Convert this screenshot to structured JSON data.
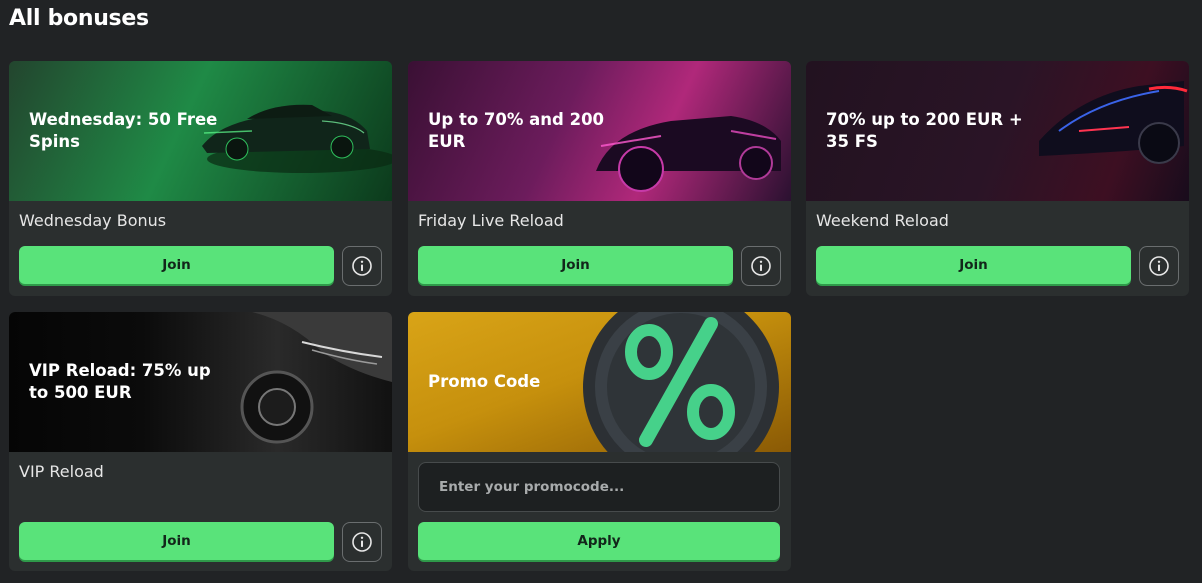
{
  "page": {
    "title": "All bonuses"
  },
  "bonuses": [
    {
      "headline": "Wednesday: 50 Free Spins",
      "name": "Wednesday Bonus",
      "button": "Join"
    },
    {
      "headline": "Up to 70% and 200 EUR",
      "name": "Friday Live Reload",
      "button": "Join"
    },
    {
      "headline": "70% up to 200 EUR + 35 FS",
      "name": "Weekend Reload",
      "button": "Join"
    },
    {
      "headline": "VIP Reload: 75% up to 500 EUR",
      "name": "VIP Reload",
      "button": "Join"
    }
  ],
  "promo": {
    "headline": "Promo Code",
    "placeholder": "Enter your promocode...",
    "button": "Apply"
  },
  "icons": {
    "info": "info-circle-icon",
    "promo": "percent-icon"
  },
  "colors": {
    "accent": "#59e37a",
    "background": "#212325",
    "card": "#2b2f2f"
  }
}
